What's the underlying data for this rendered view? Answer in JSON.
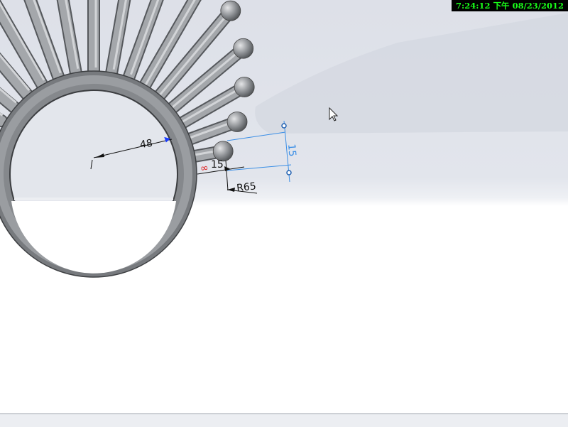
{
  "clock": {
    "time": "7:24:12",
    "ampm": "下午",
    "date": "08/23/2012",
    "color": "#1aff1a"
  },
  "dimensions": {
    "diameter": "48",
    "spoke_length": "15",
    "spoke_offset": "15",
    "radius": "R65",
    "dependent_marker": "∞"
  },
  "colors": {
    "part_gray": "#8e9195",
    "sketch_blue": "#3a8ee6",
    "dimension_black": "#111111",
    "marker_red": "#e02020"
  },
  "icons": {
    "cursor": "mouse-pointer-icon"
  }
}
